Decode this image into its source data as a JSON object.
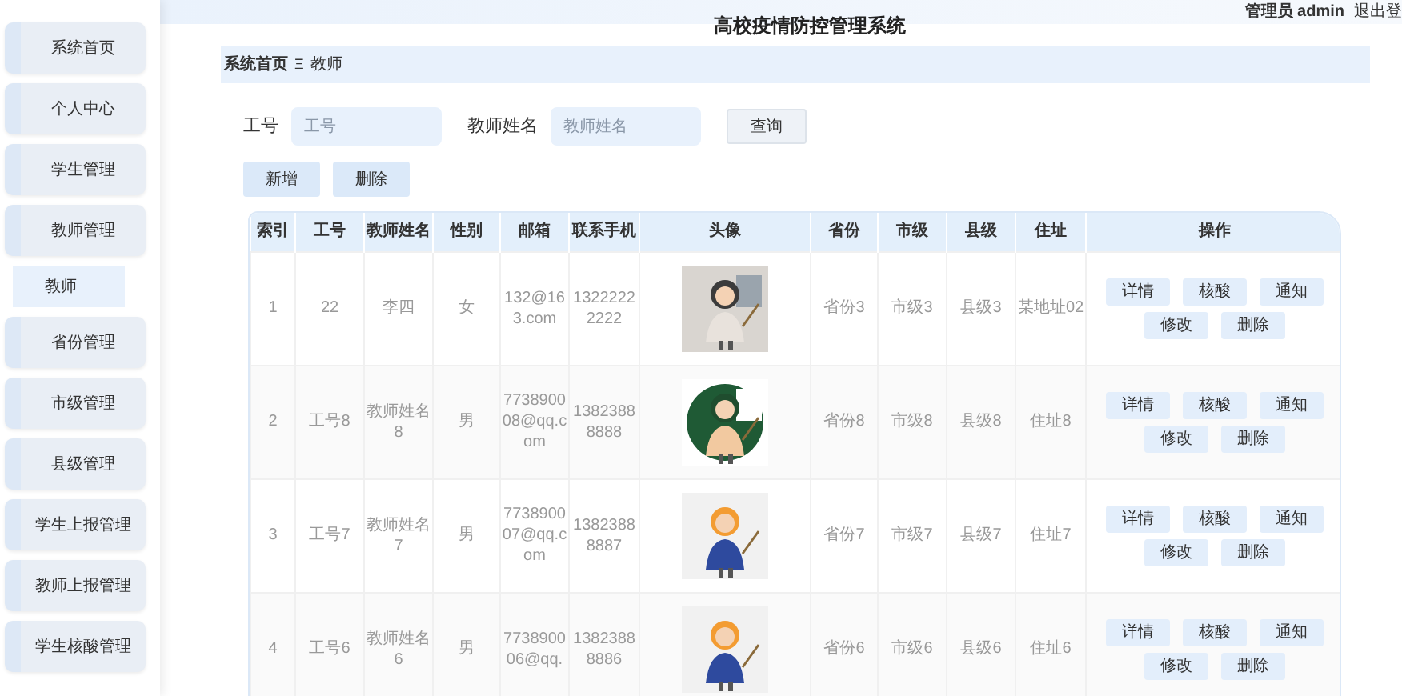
{
  "header": {
    "title": "高校疫情防控管理系统",
    "user": "管理员 admin",
    "logout": "退出登"
  },
  "sidebar": {
    "items": [
      {
        "label": "系统首页"
      },
      {
        "label": "个人中心"
      },
      {
        "label": "学生管理"
      },
      {
        "label": "教师管理",
        "children": [
          {
            "label": "教师",
            "selected": true
          }
        ]
      },
      {
        "label": "省份管理"
      },
      {
        "label": "市级管理"
      },
      {
        "label": "县级管理"
      },
      {
        "label": "学生上报管理"
      },
      {
        "label": "教师上报管理"
      },
      {
        "label": "学生核酸管理"
      }
    ]
  },
  "breadcrumb": {
    "items": [
      "系统首页",
      "教师"
    ],
    "separator": "Ξ"
  },
  "search": {
    "fields": [
      {
        "label": "工号",
        "placeholder": "工号"
      },
      {
        "label": "教师姓名",
        "placeholder": "教师姓名"
      }
    ],
    "button": "查询"
  },
  "actions": [
    "新增",
    "删除"
  ],
  "table": {
    "columns": [
      {
        "label": "索引",
        "kind": "text"
      },
      {
        "label": "工号",
        "kind": "text"
      },
      {
        "label": "教师姓名",
        "kind": "text"
      },
      {
        "label": "性别",
        "kind": "text"
      },
      {
        "label": "邮箱",
        "kind": "text"
      },
      {
        "label": "联系手机",
        "kind": "text"
      },
      {
        "label": "头像",
        "kind": "picture"
      },
      {
        "label": "省份",
        "kind": "text"
      },
      {
        "label": "市级",
        "kind": "text"
      },
      {
        "label": "县级",
        "kind": "text"
      },
      {
        "label": "住址",
        "kind": "text"
      },
      {
        "label": "操作",
        "kind": "actions"
      }
    ],
    "rows": [
      {
        "cells": [
          "1",
          "22",
          "李四",
          "女",
          "132@163.com",
          "13222222222",
          "",
          "省份3",
          "市级3",
          "县级3",
          "某地址02"
        ],
        "actions": [
          "详情",
          "核酸",
          "通知",
          "修改",
          "删除"
        ]
      },
      {
        "cells": [
          "2",
          "工号8",
          "教师姓名8",
          "男",
          "773890008@qq.com",
          "13823888888",
          "",
          "省份8",
          "市级8",
          "县级8",
          "住址8"
        ],
        "actions": [
          "详情",
          "核酸",
          "通知",
          "修改",
          "删除"
        ]
      },
      {
        "cells": [
          "3",
          "工号7",
          "教师姓名7",
          "男",
          "773890007@qq.com",
          "13823888887",
          "",
          "省份7",
          "市级7",
          "县级7",
          "住址7"
        ],
        "actions": [
          "详情",
          "核酸",
          "通知",
          "修改",
          "删除"
        ]
      },
      {
        "cells": [
          "4",
          "工号6",
          "教师姓名6",
          "男",
          "773890006@qq.",
          "13823888886",
          "",
          "省份6",
          "市级6",
          "县级6",
          "住址6"
        ],
        "actions": [
          "详情",
          "核酸",
          "通知",
          "修改",
          "删除"
        ]
      }
    ]
  }
}
